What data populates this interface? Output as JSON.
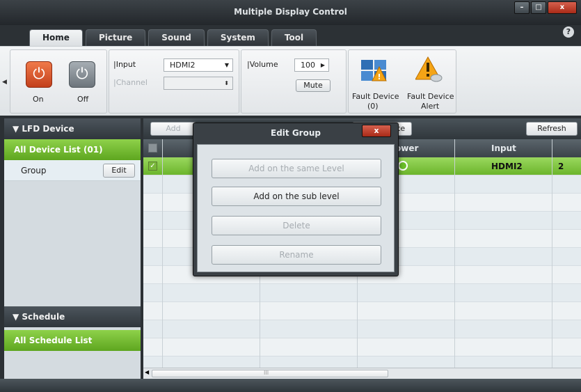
{
  "window": {
    "title": "Multiple Display Control",
    "minimize": "–",
    "maximize": "□",
    "close": "x",
    "help": "?"
  },
  "tabs": [
    "Home",
    "Picture",
    "Sound",
    "System",
    "Tool"
  ],
  "ribbon": {
    "power_on_label": "On",
    "power_off_label": "Off",
    "input_label": "Input",
    "input_value": "HDMI2",
    "channel_label": "Channel",
    "volume_label": "Volume",
    "volume_value": "100",
    "mute_label": "Mute",
    "fault_device_label": "Fault Device",
    "fault_device_count": "(0)",
    "fault_alert_label": "Fault Device",
    "fault_alert_label2": "Alert"
  },
  "sidebar": {
    "lfd_header": "LFD Device",
    "all_devices": "All Device List (01)",
    "group_label": "Group",
    "edit_label": "Edit",
    "schedule_header": "Schedule",
    "all_schedules": "All Schedule List"
  },
  "toolbar": {
    "add_label": "Add",
    "delete_label": "te",
    "refresh_label": "Refresh"
  },
  "table": {
    "headers": {
      "power": "ower",
      "input": "Input"
    },
    "row": {
      "input": "HDMI2",
      "extra": "2"
    }
  },
  "dialog": {
    "title": "Edit Group",
    "close": "x",
    "buttons": [
      "Add on the same Level",
      "Add on the sub level",
      "Delete",
      "Rename"
    ]
  },
  "scroll_mark": "III",
  "colors": {
    "accent_green": "#7cc23a",
    "power_on": "#e2613a",
    "header_dark": "#353c41"
  }
}
